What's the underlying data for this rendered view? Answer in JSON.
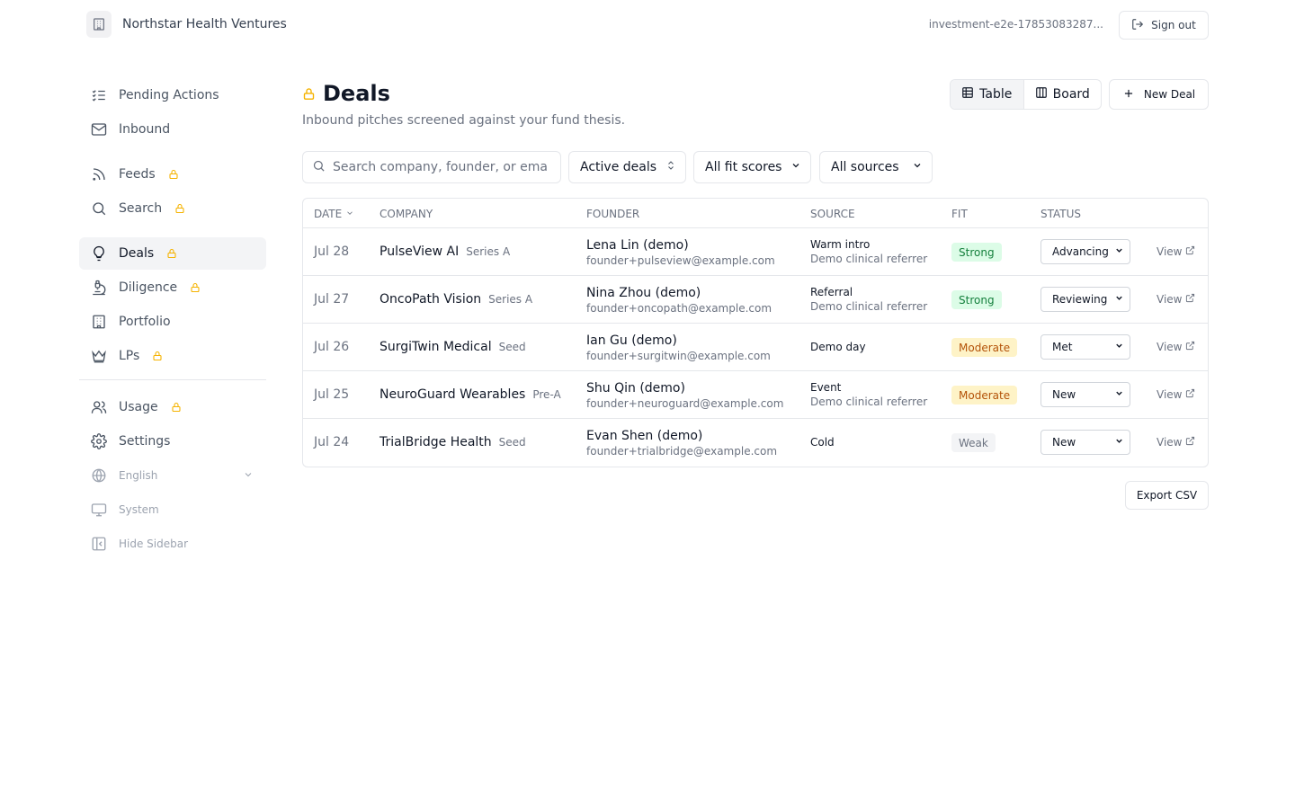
{
  "header": {
    "org_name": "Northstar Health Ventures",
    "org_icon": "building-icon",
    "account": "investment-e2e-17853083287...",
    "sign_out_label": "Sign out"
  },
  "sidebar": {
    "items": [
      {
        "label": "Pending Actions",
        "icon": "checklist-icon",
        "locked": false
      },
      {
        "label": "Inbound",
        "icon": "mail-icon",
        "locked": false
      },
      {
        "label": "Feeds",
        "icon": "rss-icon",
        "locked": true
      },
      {
        "label": "Search",
        "icon": "search-icon",
        "locked": true
      },
      {
        "label": "Deals",
        "icon": "lightbulb-icon",
        "locked": true,
        "active": true
      },
      {
        "label": "Diligence",
        "icon": "microscope-icon",
        "locked": true
      },
      {
        "label": "Portfolio",
        "icon": "building-icon",
        "locked": false
      },
      {
        "label": "LPs",
        "icon": "crown-icon",
        "locked": true
      },
      {
        "label": "Usage",
        "icon": "users-icon",
        "locked": true
      },
      {
        "label": "Settings",
        "icon": "gear-icon",
        "locked": false
      }
    ],
    "language": "English",
    "theme": "System",
    "hide_sidebar": "Hide Sidebar"
  },
  "page": {
    "title": "Deals",
    "subtitle": "Inbound pitches screened against your fund thesis.",
    "view_table": "Table",
    "view_board": "Board",
    "new_deal": "New Deal"
  },
  "filters": {
    "search_placeholder": "Search company, founder, or email",
    "scope": "Active deals",
    "fit": "All fit scores",
    "source": "All sources"
  },
  "table": {
    "columns": [
      "DATE",
      "COMPANY",
      "FOUNDER",
      "SOURCE",
      "FIT",
      "STATUS"
    ],
    "view_label": "View",
    "rows": [
      {
        "date": "Jul 28",
        "company": "PulseView AI",
        "stage": "Series A",
        "founder": "Lena Lin (demo)",
        "email": "founder+pulseview@example.com",
        "source": "Warm intro",
        "source_detail": "Demo clinical referrer",
        "fit": "Strong",
        "status": "Advancing"
      },
      {
        "date": "Jul 27",
        "company": "OncoPath Vision",
        "stage": "Series A",
        "founder": "Nina Zhou (demo)",
        "email": "founder+oncopath@example.com",
        "source": "Referral",
        "source_detail": "Demo clinical referrer",
        "fit": "Strong",
        "status": "Reviewing"
      },
      {
        "date": "Jul 26",
        "company": "SurgiTwin Medical",
        "stage": "Seed",
        "founder": "Ian Gu (demo)",
        "email": "founder+surgitwin@example.com",
        "source": "Demo day",
        "source_detail": "",
        "fit": "Moderate",
        "status": "Met"
      },
      {
        "date": "Jul 25",
        "company": "NeuroGuard Wearables",
        "stage": "Pre-A",
        "founder": "Shu Qin (demo)",
        "email": "founder+neuroguard@example.com",
        "source": "Event",
        "source_detail": "Demo clinical referrer",
        "fit": "Moderate",
        "status": "New"
      },
      {
        "date": "Jul 24",
        "company": "TrialBridge Health",
        "stage": "Seed",
        "founder": "Evan Shen (demo)",
        "email": "founder+trialbridge@example.com",
        "source": "Cold",
        "source_detail": "",
        "fit": "Weak",
        "status": "New"
      }
    ]
  },
  "export_label": "Export CSV",
  "colors": {
    "lock": "#f5b301",
    "strong_bg": "#dcfce7",
    "strong_fg": "#15803d",
    "moderate_bg": "#fef3c7",
    "moderate_fg": "#b45309",
    "weak_bg": "#f3f4f6",
    "weak_fg": "#6b7280"
  }
}
